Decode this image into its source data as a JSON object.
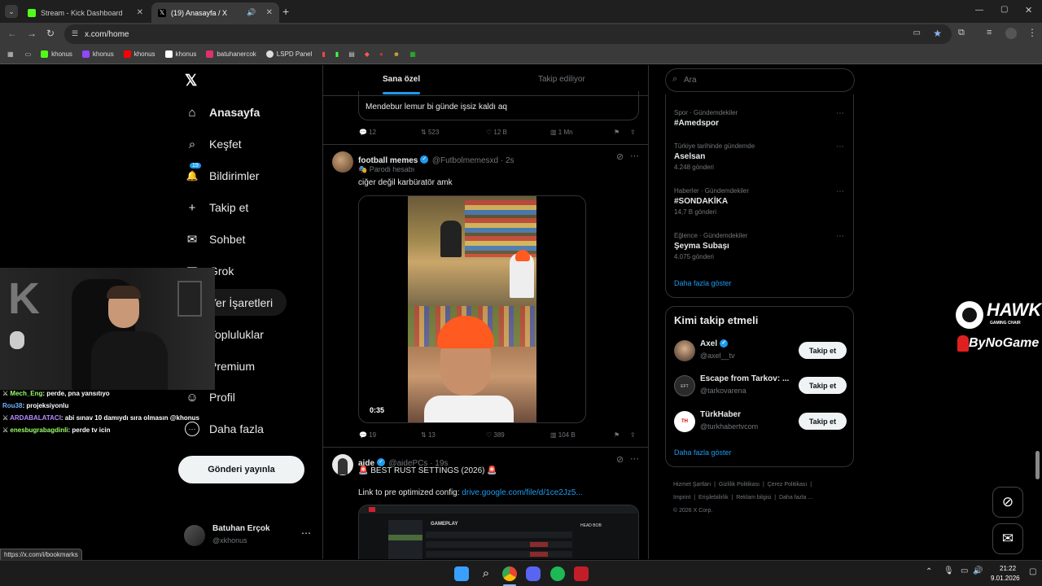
{
  "browser": {
    "tabs": [
      {
        "title": "Stream - Kick Dashboard",
        "fav_color": "#53fc18"
      },
      {
        "title": "(19) Anasayfa / X",
        "fav_color": "#ffffff"
      }
    ],
    "url": "x.com/home",
    "bookmarks": [
      {
        "label": "khonus",
        "color": "#53fc18"
      },
      {
        "label": "khonus",
        "color": "#9146ff"
      },
      {
        "label": "khonus",
        "color": "#ff0000"
      },
      {
        "label": "khonus",
        "color": "#ffffff"
      },
      {
        "label": "batuhanercok",
        "color": "#e1306c"
      },
      {
        "label": "LSPD Panel",
        "color": "#dddddd"
      }
    ],
    "status_url": "https://x.com/i/bookmarks"
  },
  "nav": {
    "items": [
      {
        "label": "Anasayfa",
        "icon": "home-icon",
        "glyph": "⌂"
      },
      {
        "label": "Keşfet",
        "icon": "search-icon",
        "glyph": "⌕"
      },
      {
        "label": "Bildirimler",
        "icon": "bell-icon",
        "glyph": "🔔"
      },
      {
        "label": "Takip et",
        "icon": "follow-icon",
        "glyph": "+"
      },
      {
        "label": "Sohbet",
        "icon": "mail-icon",
        "glyph": "✉"
      },
      {
        "label": "Grok",
        "icon": "grok-icon",
        "glyph": "◪"
      },
      {
        "label": "Yer İşaretleri",
        "icon": "bookmark-icon",
        "glyph": "⚑"
      },
      {
        "label": "Topluluklar",
        "icon": "communities-icon",
        "glyph": "⚇"
      },
      {
        "label": "Premium",
        "icon": "premium-icon",
        "glyph": "X"
      },
      {
        "label": "Profil",
        "icon": "profile-icon",
        "glyph": "☺"
      },
      {
        "label": "Daha fazla",
        "icon": "more-icon",
        "glyph": "⋯"
      }
    ],
    "notif_count": "19",
    "post_button": "Gönderi yayınla",
    "account_name": "Batuhan Erçok",
    "account_handle": "@xkhonus"
  },
  "feed": {
    "tabs": [
      "Sana özel",
      "Takip ediliyor"
    ],
    "quoted_text": "Mendebur lemur bi günde işsiz kaldı aq",
    "tweet0_stats": {
      "replies": "12",
      "reposts": "523",
      "likes": "12 B",
      "views": "1 Mn"
    },
    "tweet1": {
      "name": "football memes",
      "handle": "@Futbolmemesxd · 2s",
      "label": "Parodi hesabı",
      "text": "ciğer değil karbüratör amk",
      "video_time": "0:35",
      "replies": "19",
      "reposts": "13",
      "likes": "389",
      "views": "104 B"
    },
    "tweet2": {
      "name": "aide",
      "handle": "@aidePCs · 19s",
      "text": "🚨 BEST RUST SETTINGS (2026) 🚨",
      "link_prefix": "Link to pre optimized config: ",
      "link": "drive.google.com/file/d/1ce2Jz5...",
      "settings_tab": "GAMEPLAY",
      "settings_header": "HEAD BOB"
    }
  },
  "sidebar": {
    "search_placeholder": "Ara",
    "trends": [
      {
        "category": "Spor · Gündemdekiler",
        "topic": "#Amedspor",
        "count": ""
      },
      {
        "category": "Türkiye tarihinde gündemde",
        "topic": "Aselsan",
        "count": "4.248 gönderi"
      },
      {
        "category": "Haberler · Gündemdekiler",
        "topic": "#SONDAKİKA",
        "count": "14,7 B gönderi"
      },
      {
        "category": "Eğlence · Gündemdekiler",
        "topic": "Şeyma Subaşı",
        "count": "4.075 gönderi"
      }
    ],
    "show_more": "Daha fazla göster",
    "who_title": "Kimi takip etmeli",
    "who": [
      {
        "name": "Axel",
        "handle": "@axel__tv",
        "verified": true
      },
      {
        "name": "Escape from Tarkov: ...",
        "handle": "@tarkovarena",
        "verified": false
      },
      {
        "name": "TürkHaber",
        "handle": "@turkhabertvcom",
        "verified": false
      }
    ],
    "follow_label": "Takip et",
    "who_show_more": "Daha fazla göster",
    "footer_links": [
      "Hizmet Şartları",
      "Gizlilik Politikası",
      "Çerez Politikası",
      "Imprint",
      "Erişilebilirlik",
      "Reklam bilgisi",
      "Daha fazla ..."
    ],
    "copyright": "© 2026 X Corp."
  },
  "overlay": {
    "chat": [
      {
        "user": "Mech_Eng",
        "color": "#9bff6b",
        "msg": ": perde, pna yansıtıyo"
      },
      {
        "user": "Rou38",
        "color": "#6fb4ff",
        "msg": ": projeksiyonlu"
      },
      {
        "user": "ARDABALATACI",
        "color": "#b98bff",
        "msg": ": abi sınav 10 damıydı sıra olmasın @khonus"
      },
      {
        "user": "enesbugrabagdinli",
        "color": "#9bff6b",
        "msg": ": perde tv icin"
      }
    ],
    "sponsor_top": "HAWK",
    "sponsor_sub": "GAMING CHAIR",
    "sponsor_bottom": "ByNoGame"
  },
  "taskbar": {
    "time": "21:22",
    "date": "9.01.2026"
  }
}
